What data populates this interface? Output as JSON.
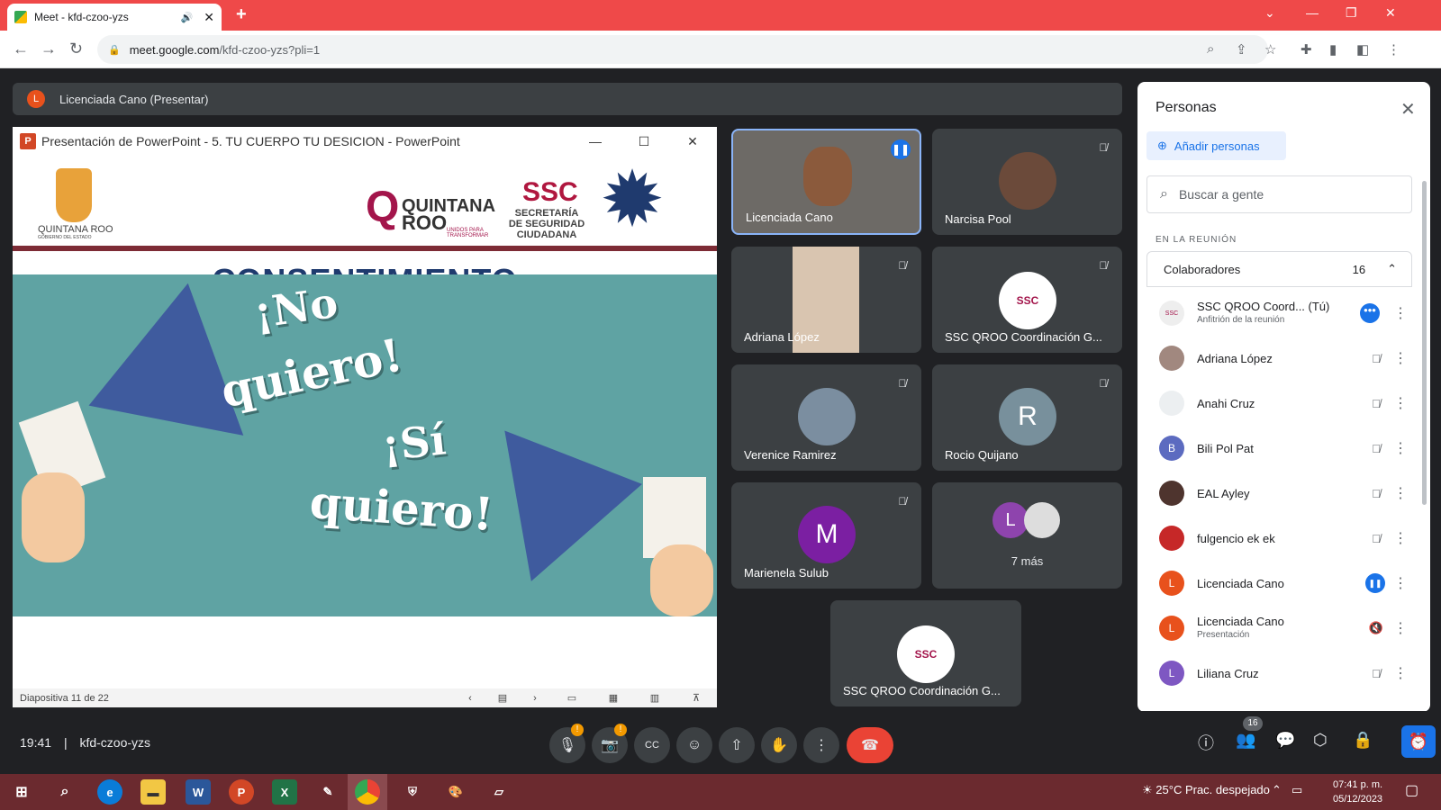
{
  "browser": {
    "tab_title": "Meet - kfd-czoo-yzs",
    "new_tab": "+",
    "url_domain": "meet.google.com",
    "url_path": "/kfd-czoo-yzs?pli=1"
  },
  "presenting_bar": {
    "avatar": "L",
    "label": "Licenciada Cano (Presentar)"
  },
  "ppt": {
    "title": "Presentación de PowerPoint  -  5. TU CUERPO TU DESICION - PowerPoint",
    "status": "Diapositiva 11 de 22",
    "slide": {
      "org1": "QUINTANA ROO",
      "org1_sub": "GOBIERNO DEL ESTADO",
      "logo2": "QUINTANA",
      "logo2b": "ROO",
      "logo2_sub": "UNIDOS PARA TRANSFORMAR",
      "ssc": "SSC",
      "ssc_sub1": "SECRETARÍA",
      "ssc_sub2": "DE SEGURIDAD",
      "ssc_sub3": "CIUDADANA",
      "heading": "CONSENTIMIENTO",
      "q1a": "¡No",
      "q1b": "quiero!",
      "q2a": "¡Sí",
      "q2b": "quiero!"
    }
  },
  "tiles": [
    {
      "name": "Licenciada Cano"
    },
    {
      "name": "Narcisa Pool"
    },
    {
      "name": "Adriana López"
    },
    {
      "name": "SSC QROO Coordinación G..."
    },
    {
      "name": "Verenice Ramirez"
    },
    {
      "name": "Rocio Quijano",
      "initial": "R"
    },
    {
      "name": "Marienela Sulub",
      "initial": "M"
    },
    {
      "more": "7 más",
      "initial": "L"
    },
    {
      "name": "SSC QROO Coordinación G..."
    }
  ],
  "panel": {
    "title": "Personas",
    "add": "Añadir personas",
    "search_placeholder": "Buscar a gente",
    "in_meeting": "EN LA REUNIÓN",
    "collab_label": "Colaboradores",
    "collab_count": "16",
    "people": [
      {
        "name": "SSC QROO Coord... (Tú)",
        "sub": "Anfitrión de la reunión",
        "initial": ""
      },
      {
        "name": "Adriana López",
        "initial": ""
      },
      {
        "name": "Anahi Cruz",
        "initial": ""
      },
      {
        "name": "Bili Pol Pat",
        "initial": "B"
      },
      {
        "name": "EAL Ayley",
        "initial": ""
      },
      {
        "name": "fulgencio ek ek",
        "initial": ""
      },
      {
        "name": "Licenciada Cano",
        "initial": "L"
      },
      {
        "name": "Licenciada Cano",
        "sub": "Presentación",
        "initial": "L"
      },
      {
        "name": "Liliana Cruz",
        "initial": "L"
      }
    ]
  },
  "bottom": {
    "time": "19:41",
    "meeting_code": "kfd-czoo-yzs",
    "people_badge": "16"
  },
  "taskbar": {
    "weather": "25°C  Prac. despejado",
    "time": "07:41 p. m.",
    "date": "05/12/2023"
  },
  "colors": {
    "tabbar": "#ef4949",
    "end_call": "#ea4335",
    "accent": "#1a73e8"
  }
}
